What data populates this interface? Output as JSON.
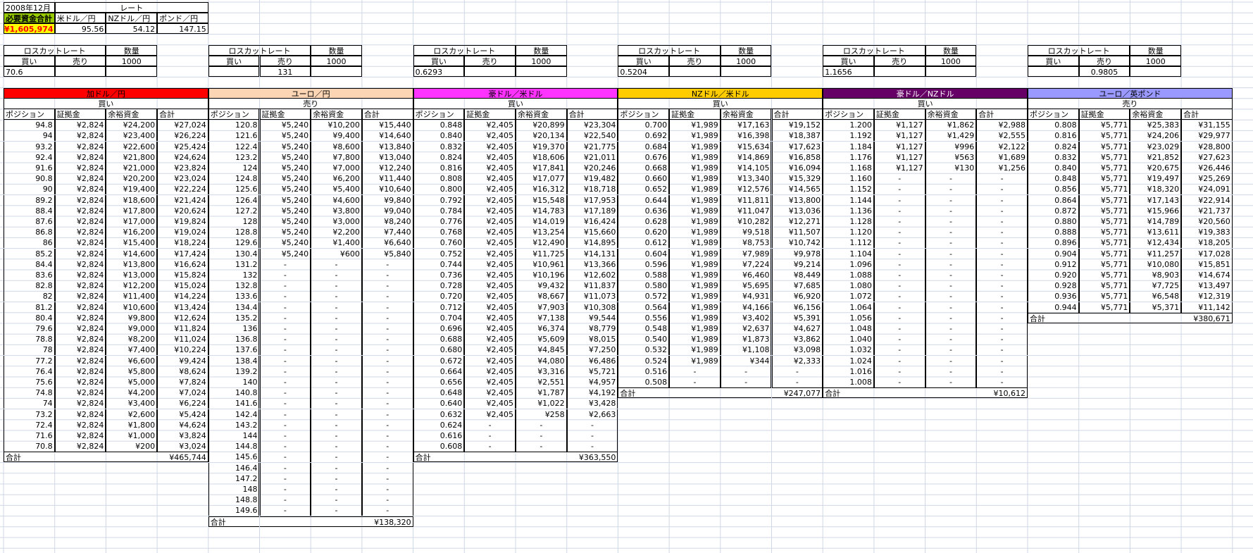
{
  "top": {
    "month": "2008年12月",
    "rate_label": "レート",
    "required_label": "必要資金合計",
    "required_value": "¥1,605,974",
    "rates": [
      {
        "label": "米ドル／円",
        "value": "95.56"
      },
      {
        "label": "NZドル／円",
        "value": "54.12"
      },
      {
        "label": "ポンド／円",
        "value": "147.15"
      }
    ]
  },
  "losscut": [
    {
      "title": "ロスカットレート",
      "qty_label": "数量",
      "buy_label": "買い",
      "sell_label": "売り",
      "qty": "1000",
      "buy": "70.6",
      "sell": ""
    },
    {
      "title": "ロスカットレート",
      "qty_label": "数量",
      "buy_label": "買い",
      "sell_label": "売り",
      "qty": "1000",
      "buy": "",
      "sell": "131"
    },
    {
      "title": "ロスカットレート",
      "qty_label": "数量",
      "buy_label": "買い",
      "sell_label": "売り",
      "qty": "1000",
      "buy": "0.6293",
      "sell": ""
    },
    {
      "title": "ロスカットレート",
      "qty_label": "数量",
      "buy_label": "買い",
      "sell_label": "売り",
      "qty": "1000",
      "buy": "0.5204",
      "sell": ""
    },
    {
      "title": "ロスカットレート",
      "qty_label": "数量",
      "buy_label": "買い",
      "sell_label": "売り",
      "qty": "1000",
      "buy": "1.1656",
      "sell": ""
    },
    {
      "title": "ロスカットレート",
      "qty_label": "数量",
      "buy_label": "買い",
      "sell_label": "売り",
      "qty": "1000",
      "buy": "",
      "sell": "0.9805"
    }
  ],
  "col_headers": [
    "ポジション",
    "証拠金",
    "余裕資金",
    "合計"
  ],
  "total_label": "合計",
  "tables": [
    {
      "name": "加ドル／円",
      "side": "買い",
      "color": "#ff0000",
      "text_color": "#000000",
      "rows": [
        [
          "94.8",
          "¥2,824",
          "¥24,200",
          "¥27,024"
        ],
        [
          "94",
          "¥2,824",
          "¥23,400",
          "¥26,224"
        ],
        [
          "93.2",
          "¥2,824",
          "¥22,600",
          "¥25,424"
        ],
        [
          "92.4",
          "¥2,824",
          "¥21,800",
          "¥24,624"
        ],
        [
          "91.6",
          "¥2,824",
          "¥21,000",
          "¥23,824"
        ],
        [
          "90.8",
          "¥2,824",
          "¥20,200",
          "¥23,024"
        ],
        [
          "90",
          "¥2,824",
          "¥19,400",
          "¥22,224"
        ],
        [
          "89.2",
          "¥2,824",
          "¥18,600",
          "¥21,424"
        ],
        [
          "88.4",
          "¥2,824",
          "¥17,800",
          "¥20,624"
        ],
        [
          "87.6",
          "¥2,824",
          "¥17,000",
          "¥19,824"
        ],
        [
          "86.8",
          "¥2,824",
          "¥16,200",
          "¥19,024"
        ],
        [
          "86",
          "¥2,824",
          "¥15,400",
          "¥18,224"
        ],
        [
          "85.2",
          "¥2,824",
          "¥14,600",
          "¥17,424"
        ],
        [
          "84.4",
          "¥2,824",
          "¥13,800",
          "¥16,624"
        ],
        [
          "83.6",
          "¥2,824",
          "¥13,000",
          "¥15,824"
        ],
        [
          "82.8",
          "¥2,824",
          "¥12,200",
          "¥15,024"
        ],
        [
          "82",
          "¥2,824",
          "¥11,400",
          "¥14,224"
        ],
        [
          "81.2",
          "¥2,824",
          "¥10,600",
          "¥13,424"
        ],
        [
          "80.4",
          "¥2,824",
          "¥9,800",
          "¥12,624"
        ],
        [
          "79.6",
          "¥2,824",
          "¥9,000",
          "¥11,824"
        ],
        [
          "78.8",
          "¥2,824",
          "¥8,200",
          "¥11,024"
        ],
        [
          "78",
          "¥2,824",
          "¥7,400",
          "¥10,224"
        ],
        [
          "77.2",
          "¥2,824",
          "¥6,600",
          "¥9,424"
        ],
        [
          "76.4",
          "¥2,824",
          "¥5,800",
          "¥8,624"
        ],
        [
          "75.6",
          "¥2,824",
          "¥5,000",
          "¥7,824"
        ],
        [
          "74.8",
          "¥2,824",
          "¥4,200",
          "¥7,024"
        ],
        [
          "74",
          "¥2,824",
          "¥3,400",
          "¥6,224"
        ],
        [
          "73.2",
          "¥2,824",
          "¥2,600",
          "¥5,424"
        ],
        [
          "72.4",
          "¥2,824",
          "¥1,800",
          "¥4,624"
        ],
        [
          "71.6",
          "¥2,824",
          "¥1,000",
          "¥3,824"
        ],
        [
          "70.8",
          "¥2,824",
          "¥200",
          "¥3,024"
        ]
      ],
      "total": "¥465,744"
    },
    {
      "name": "ユーロ／円",
      "side": "売り",
      "color": "#fcd5b4",
      "text_color": "#000000",
      "rows": [
        [
          "120.8",
          "¥5,240",
          "¥10,200",
          "¥15,440"
        ],
        [
          "121.6",
          "¥5,240",
          "¥9,400",
          "¥14,640"
        ],
        [
          "122.4",
          "¥5,240",
          "¥8,600",
          "¥13,840"
        ],
        [
          "123.2",
          "¥5,240",
          "¥7,800",
          "¥13,040"
        ],
        [
          "124",
          "¥5,240",
          "¥7,000",
          "¥12,240"
        ],
        [
          "124.8",
          "¥5,240",
          "¥6,200",
          "¥11,440"
        ],
        [
          "125.6",
          "¥5,240",
          "¥5,400",
          "¥10,640"
        ],
        [
          "126.4",
          "¥5,240",
          "¥4,600",
          "¥9,840"
        ],
        [
          "127.2",
          "¥5,240",
          "¥3,800",
          "¥9,040"
        ],
        [
          "128",
          "¥5,240",
          "¥3,000",
          "¥8,240"
        ],
        [
          "128.8",
          "¥5,240",
          "¥2,200",
          "¥7,440"
        ],
        [
          "129.6",
          "¥5,240",
          "¥1,400",
          "¥6,640"
        ],
        [
          "130.4",
          "¥5,240",
          "¥600",
          "¥5,840"
        ],
        [
          "131.2",
          "-",
          "-",
          "-"
        ],
        [
          "132",
          "-",
          "-",
          "-"
        ],
        [
          "132.8",
          "-",
          "-",
          "-"
        ],
        [
          "133.6",
          "-",
          "-",
          "-"
        ],
        [
          "134.4",
          "-",
          "-",
          "-"
        ],
        [
          "135.2",
          "-",
          "-",
          "-"
        ],
        [
          "136",
          "-",
          "-",
          "-"
        ],
        [
          "136.8",
          "-",
          "-",
          "-"
        ],
        [
          "137.6",
          "-",
          "-",
          "-"
        ],
        [
          "138.4",
          "-",
          "-",
          "-"
        ],
        [
          "139.2",
          "-",
          "-",
          "-"
        ],
        [
          "140",
          "-",
          "-",
          "-"
        ],
        [
          "140.8",
          "-",
          "-",
          "-"
        ],
        [
          "141.6",
          "-",
          "-",
          "-"
        ],
        [
          "142.4",
          "-",
          "-",
          "-"
        ],
        [
          "143.2",
          "-",
          "-",
          "-"
        ],
        [
          "144",
          "-",
          "-",
          "-"
        ],
        [
          "144.8",
          "-",
          "-",
          "-"
        ],
        [
          "145.6",
          "-",
          "-",
          "-"
        ],
        [
          "146.4",
          "-",
          "-",
          "-"
        ],
        [
          "147.2",
          "-",
          "-",
          "-"
        ],
        [
          "148",
          "-",
          "-",
          "-"
        ],
        [
          "148.8",
          "-",
          "-",
          "-"
        ],
        [
          "149.6",
          "-",
          "-",
          "-"
        ]
      ],
      "total": "¥138,320"
    },
    {
      "name": "豪ドル／米ドル",
      "side": "買い",
      "color": "#ff33ff",
      "text_color": "#000000",
      "rows": [
        [
          "0.848",
          "¥2,405",
          "¥20,899",
          "¥23,304"
        ],
        [
          "0.840",
          "¥2,405",
          "¥20,134",
          "¥22,540"
        ],
        [
          "0.832",
          "¥2,405",
          "¥19,370",
          "¥21,775"
        ],
        [
          "0.824",
          "¥2,405",
          "¥18,606",
          "¥21,011"
        ],
        [
          "0.816",
          "¥2,405",
          "¥17,841",
          "¥20,246"
        ],
        [
          "0.808",
          "¥2,405",
          "¥17,077",
          "¥19,482"
        ],
        [
          "0.800",
          "¥2,405",
          "¥16,312",
          "¥18,718"
        ],
        [
          "0.792",
          "¥2,405",
          "¥15,548",
          "¥17,953"
        ],
        [
          "0.784",
          "¥2,405",
          "¥14,783",
          "¥17,189"
        ],
        [
          "0.776",
          "¥2,405",
          "¥14,019",
          "¥16,424"
        ],
        [
          "0.768",
          "¥2,405",
          "¥13,254",
          "¥15,660"
        ],
        [
          "0.760",
          "¥2,405",
          "¥12,490",
          "¥14,895"
        ],
        [
          "0.752",
          "¥2,405",
          "¥11,725",
          "¥14,131"
        ],
        [
          "0.744",
          "¥2,405",
          "¥10,961",
          "¥13,366"
        ],
        [
          "0.736",
          "¥2,405",
          "¥10,196",
          "¥12,602"
        ],
        [
          "0.728",
          "¥2,405",
          "¥9,432",
          "¥11,837"
        ],
        [
          "0.720",
          "¥2,405",
          "¥8,667",
          "¥11,073"
        ],
        [
          "0.712",
          "¥2,405",
          "¥7,903",
          "¥10,308"
        ],
        [
          "0.704",
          "¥2,405",
          "¥7,138",
          "¥9,544"
        ],
        [
          "0.696",
          "¥2,405",
          "¥6,374",
          "¥8,779"
        ],
        [
          "0.688",
          "¥2,405",
          "¥5,609",
          "¥8,015"
        ],
        [
          "0.680",
          "¥2,405",
          "¥4,845",
          "¥7,250"
        ],
        [
          "0.672",
          "¥2,405",
          "¥4,080",
          "¥6,486"
        ],
        [
          "0.664",
          "¥2,405",
          "¥3,316",
          "¥5,721"
        ],
        [
          "0.656",
          "¥2,405",
          "¥2,551",
          "¥4,957"
        ],
        [
          "0.648",
          "¥2,405",
          "¥1,787",
          "¥4,192"
        ],
        [
          "0.640",
          "¥2,405",
          "¥1,022",
          "¥3,428"
        ],
        [
          "0.632",
          "¥2,405",
          "¥258",
          "¥2,663"
        ],
        [
          "0.624",
          "-",
          "-",
          "-"
        ],
        [
          "0.616",
          "-",
          "-",
          "-"
        ],
        [
          "0.608",
          "-",
          "-",
          "-"
        ]
      ],
      "total": "¥363,550"
    },
    {
      "name": "NZドル／米ドル",
      "side": "買い",
      "color": "#ffcc00",
      "text_color": "#000000",
      "rows": [
        [
          "0.700",
          "¥1,989",
          "¥17,163",
          "¥19,152"
        ],
        [
          "0.692",
          "¥1,989",
          "¥16,398",
          "¥18,387"
        ],
        [
          "0.684",
          "¥1,989",
          "¥15,634",
          "¥17,623"
        ],
        [
          "0.676",
          "¥1,989",
          "¥14,869",
          "¥16,858"
        ],
        [
          "0.668",
          "¥1,989",
          "¥14,105",
          "¥16,094"
        ],
        [
          "0.660",
          "¥1,989",
          "¥13,340",
          "¥15,329"
        ],
        [
          "0.652",
          "¥1,989",
          "¥12,576",
          "¥14,565"
        ],
        [
          "0.644",
          "¥1,989",
          "¥11,811",
          "¥13,800"
        ],
        [
          "0.636",
          "¥1,989",
          "¥11,047",
          "¥13,036"
        ],
        [
          "0.628",
          "¥1,989",
          "¥10,282",
          "¥12,271"
        ],
        [
          "0.620",
          "¥1,989",
          "¥9,518",
          "¥11,507"
        ],
        [
          "0.612",
          "¥1,989",
          "¥8,753",
          "¥10,742"
        ],
        [
          "0.604",
          "¥1,989",
          "¥7,989",
          "¥9,978"
        ],
        [
          "0.596",
          "¥1,989",
          "¥7,224",
          "¥9,214"
        ],
        [
          "0.588",
          "¥1,989",
          "¥6,460",
          "¥8,449"
        ],
        [
          "0.580",
          "¥1,989",
          "¥5,695",
          "¥7,685"
        ],
        [
          "0.572",
          "¥1,989",
          "¥4,931",
          "¥6,920"
        ],
        [
          "0.564",
          "¥1,989",
          "¥4,166",
          "¥6,156"
        ],
        [
          "0.556",
          "¥1,989",
          "¥3,402",
          "¥5,391"
        ],
        [
          "0.548",
          "¥1,989",
          "¥2,637",
          "¥4,627"
        ],
        [
          "0.540",
          "¥1,989",
          "¥1,873",
          "¥3,862"
        ],
        [
          "0.532",
          "¥1,989",
          "¥1,108",
          "¥3,098"
        ],
        [
          "0.524",
          "¥1,989",
          "¥344",
          "¥2,333"
        ],
        [
          "0.516",
          "-",
          "-",
          "-"
        ],
        [
          "0.508",
          "-",
          "-",
          "-"
        ]
      ],
      "total": "¥247,077"
    },
    {
      "name": "豪ドル／NZドル",
      "side": "買い",
      "color": "#660066",
      "text_color": "#ffffff",
      "rows": [
        [
          "1.200",
          "¥1,127",
          "¥1,862",
          "¥2,988"
        ],
        [
          "1.192",
          "¥1,127",
          "¥1,429",
          "¥2,555"
        ],
        [
          "1.184",
          "¥1,127",
          "¥996",
          "¥2,122"
        ],
        [
          "1.176",
          "¥1,127",
          "¥563",
          "¥1,689"
        ],
        [
          "1.168",
          "¥1,127",
          "¥130",
          "¥1,256"
        ],
        [
          "1.160",
          "-",
          "-",
          "-"
        ],
        [
          "1.152",
          "-",
          "-",
          "-"
        ],
        [
          "1.144",
          "-",
          "-",
          "-"
        ],
        [
          "1.136",
          "-",
          "-",
          "-"
        ],
        [
          "1.128",
          "-",
          "-",
          "-"
        ],
        [
          "1.120",
          "-",
          "-",
          "-"
        ],
        [
          "1.112",
          "-",
          "-",
          "-"
        ],
        [
          "1.104",
          "-",
          "-",
          "-"
        ],
        [
          "1.096",
          "-",
          "-",
          "-"
        ],
        [
          "1.088",
          "-",
          "-",
          "-"
        ],
        [
          "1.080",
          "-",
          "-",
          "-"
        ],
        [
          "1.072",
          "-",
          "-",
          "-"
        ],
        [
          "1.064",
          "-",
          "-",
          "-"
        ],
        [
          "1.056",
          "-",
          "-",
          "-"
        ],
        [
          "1.048",
          "-",
          "-",
          "-"
        ],
        [
          "1.040",
          "-",
          "-",
          "-"
        ],
        [
          "1.032",
          "-",
          "-",
          "-"
        ],
        [
          "1.024",
          "-",
          "-",
          "-"
        ],
        [
          "1.016",
          "-",
          "-",
          "-"
        ],
        [
          "1.008",
          "-",
          "-",
          "-"
        ]
      ],
      "total": "¥10,612"
    },
    {
      "name": "ユーロ／英ポンド",
      "side": "売り",
      "color": "#9999ff",
      "text_color": "#000000",
      "rows": [
        [
          "0.808",
          "¥5,771",
          "¥25,383",
          "¥31,155"
        ],
        [
          "0.816",
          "¥5,771",
          "¥24,206",
          "¥29,977"
        ],
        [
          "0.824",
          "¥5,771",
          "¥23,029",
          "¥28,800"
        ],
        [
          "0.832",
          "¥5,771",
          "¥21,852",
          "¥27,623"
        ],
        [
          "0.840",
          "¥5,771",
          "¥20,675",
          "¥26,446"
        ],
        [
          "0.848",
          "¥5,771",
          "¥19,497",
          "¥25,269"
        ],
        [
          "0.856",
          "¥5,771",
          "¥18,320",
          "¥24,091"
        ],
        [
          "0.864",
          "¥5,771",
          "¥17,143",
          "¥22,914"
        ],
        [
          "0.872",
          "¥5,771",
          "¥15,966",
          "¥21,737"
        ],
        [
          "0.880",
          "¥5,771",
          "¥14,789",
          "¥20,560"
        ],
        [
          "0.888",
          "¥5,771",
          "¥13,611",
          "¥19,383"
        ],
        [
          "0.896",
          "¥5,771",
          "¥12,434",
          "¥18,205"
        ],
        [
          "0.904",
          "¥5,771",
          "¥11,257",
          "¥17,028"
        ],
        [
          "0.912",
          "¥5,771",
          "¥10,080",
          "¥15,851"
        ],
        [
          "0.920",
          "¥5,771",
          "¥8,903",
          "¥14,674"
        ],
        [
          "0.928",
          "¥5,771",
          "¥7,725",
          "¥13,497"
        ],
        [
          "0.936",
          "¥5,771",
          "¥6,548",
          "¥12,319"
        ],
        [
          "0.944",
          "¥5,771",
          "¥5,371",
          "¥11,142"
        ]
      ],
      "total": "¥380,671"
    }
  ]
}
